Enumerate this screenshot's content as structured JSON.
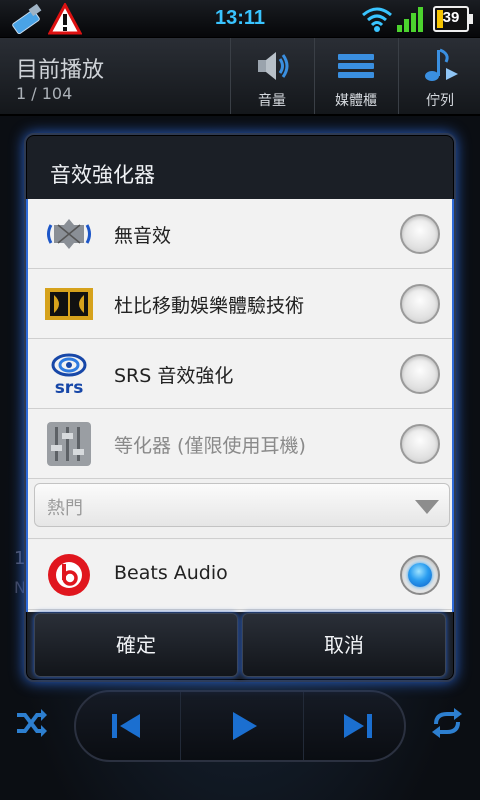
{
  "status_bar": {
    "time": "13:11",
    "battery": "39",
    "icons": [
      "usb-icon",
      "warning-icon",
      "wifi-icon",
      "signal-icon",
      "battery-icon"
    ]
  },
  "player": {
    "title": "目前播放",
    "track_count": "1 / 104",
    "toolbar": [
      {
        "icon": "speaker-icon",
        "label": "音量"
      },
      {
        "icon": "library-icon",
        "label": "媒體櫃"
      },
      {
        "icon": "queue-icon",
        "label": "佇列"
      }
    ],
    "ghost_track_line_1": "1",
    "ghost_track_line_2": "N"
  },
  "dialog": {
    "title": "音效強化器",
    "options": [
      {
        "label": "無音效",
        "icon": "no-effect-icon",
        "checked": false,
        "enabled": true
      },
      {
        "label": "杜比移動娛樂體驗技術",
        "icon": "dolby-icon",
        "checked": false,
        "enabled": true
      },
      {
        "label": "SRS 音效強化",
        "icon": "srs-icon",
        "checked": false,
        "enabled": true
      },
      {
        "label": "等化器 (僅限使用耳機)",
        "icon": "equalizer-icon",
        "checked": false,
        "enabled": false
      },
      {
        "label": "Beats Audio",
        "icon": "beats-icon",
        "checked": true,
        "enabled": true
      }
    ],
    "preset_spinner": {
      "value": "熱門"
    },
    "buttons": {
      "ok": "確定",
      "cancel": "取消"
    }
  },
  "colors": {
    "accent": "#2b62c9",
    "time": "#39c4ff",
    "battery_fill": "#f5c400",
    "beats_red": "#e0161e"
  }
}
